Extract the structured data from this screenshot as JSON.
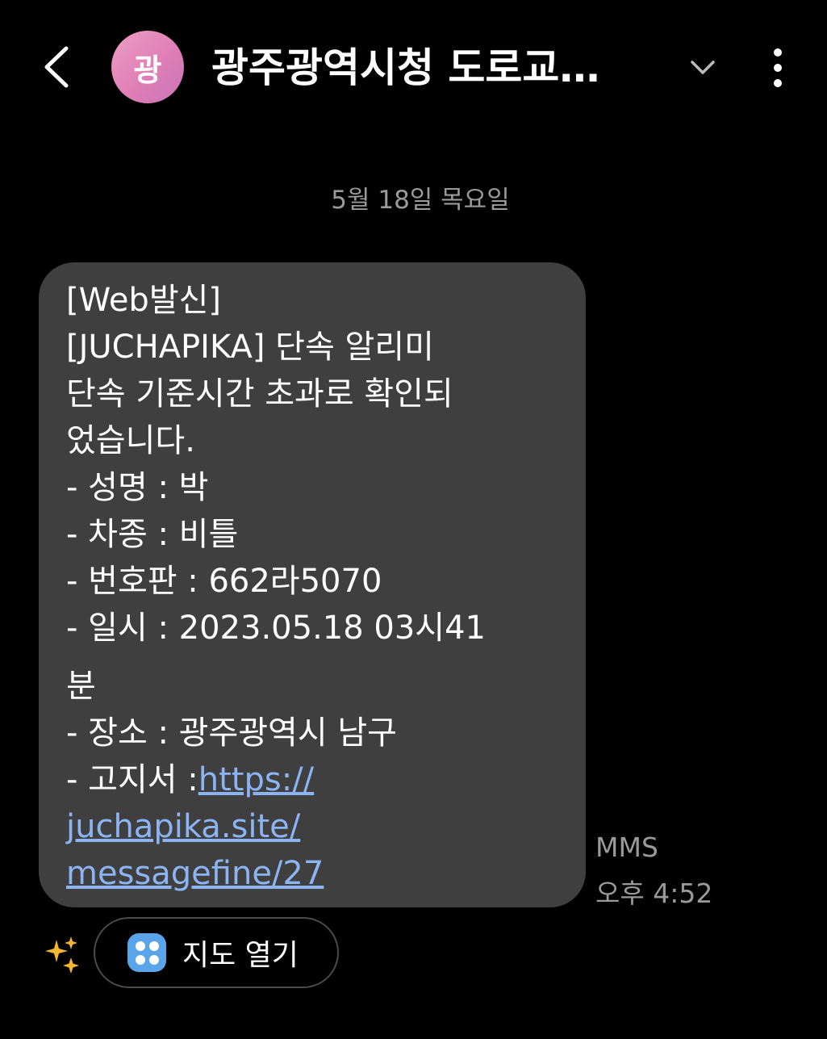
{
  "header": {
    "avatar_initial": "광",
    "title": "광주광역시청 도로교…",
    "icons": [
      "back-arrow-icon",
      "chevron-down-icon",
      "more-vertical-icon"
    ],
    "avatar_color": "#e48cbd"
  },
  "date_divider": "5월 18일 목요일",
  "message": {
    "lines": [
      "[Web발신]",
      "[JUCHAPIKA] 단속 알리미",
      "단속 기준시간 초과로 확인되",
      "었습니다.",
      "- 성명 : 박",
      "- 차종 : 비틀",
      "- 번호판 : 662라5070",
      "- 일시 : 2023.05.18 03시41",
      "분",
      "- 장소 : 광주광역시 남구",
      "- 고지서 :"
    ],
    "link_lines": [
      "https://",
      "juchapika.site/",
      "messagefine/27"
    ],
    "type": "MMS",
    "time": "오후 4:52",
    "bubble_color": "#3f3f3f",
    "link_color": "#8cb4f2"
  },
  "suggestion": {
    "label": "지도 열기",
    "icon": "map-apps-icon",
    "sparkle_icon": "sparkle-icon",
    "icon_color": "#5aa4ea"
  }
}
